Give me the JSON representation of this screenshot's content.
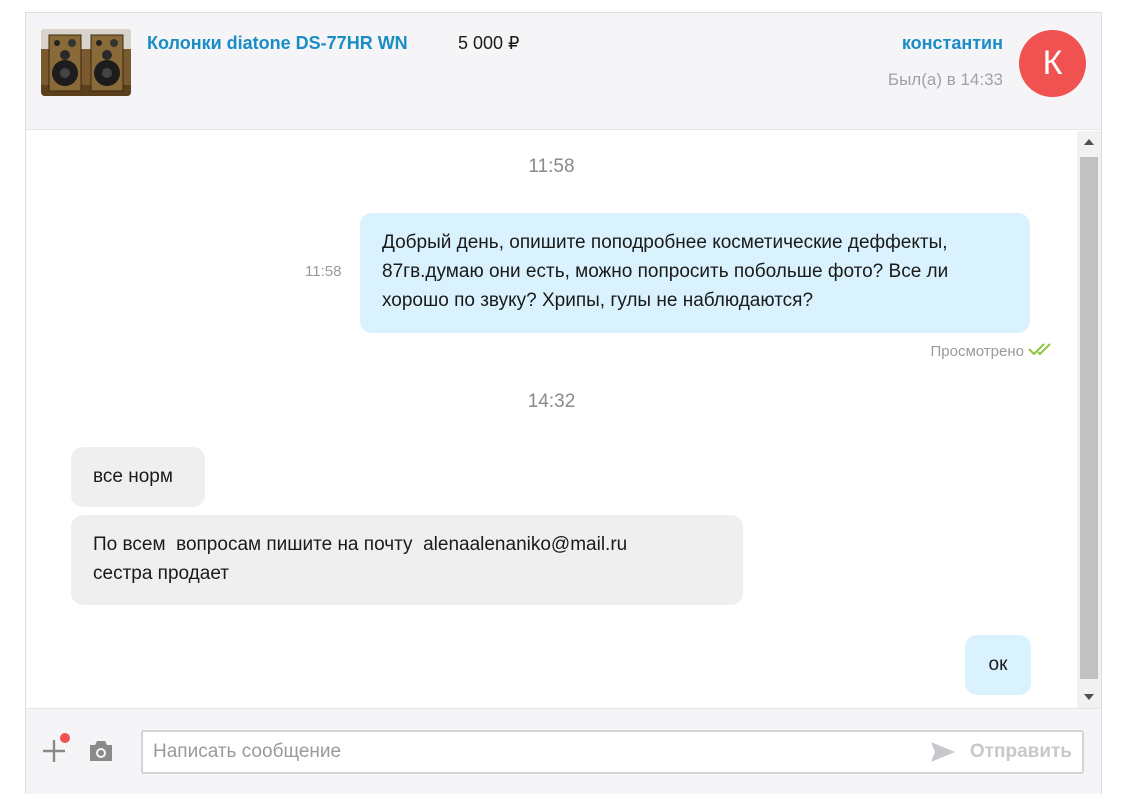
{
  "header": {
    "product_title": "Колонки diatone DS-77HR WN",
    "product_price": "5 000 ₽",
    "contact_name": "константин",
    "contact_status": "Был(а) в 14:33",
    "avatar_letter": "К",
    "avatar_color": "#f05252",
    "accent_color": "#1a8dc4"
  },
  "messages": {
    "date_1": "11:58",
    "out_1_text": "Добрый день, опишите поподробнее косметические деффекты, 87гв.думаю они есть, можно попросить побольше фото? Все ли хорошо по звуку? Хрипы, гулы не наблюдаются?",
    "out_1_time": "11:58",
    "read_status": "Просмотрено",
    "date_2": "14:32",
    "in_1_text": "все норм",
    "in_2_text_line1": "По всем  вопросам пишите на почту  alenaalenaniko@mail.ru",
    "in_2_text_line2": "сестра продает",
    "out_2_text": "ок",
    "outgoing_bubble_color": "#d9f2fd",
    "incoming_bubble_color": "#efefef"
  },
  "composer": {
    "placeholder": "Написать сообщение",
    "send_label": "Отправить"
  }
}
